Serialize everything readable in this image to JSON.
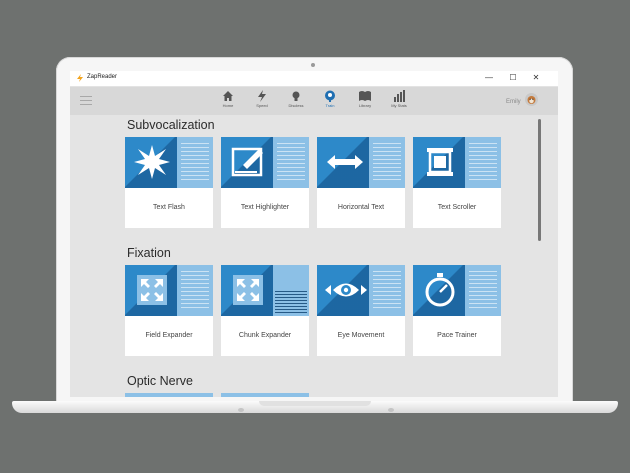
{
  "window": {
    "title": "ZapReader",
    "minimize": "—",
    "maximize": "☐",
    "close": "✕"
  },
  "nav": {
    "items": [
      {
        "label": "Home",
        "icon": "home-icon"
      },
      {
        "label": "Speed",
        "icon": "lightning-icon"
      },
      {
        "label": "Discless",
        "icon": "lightbulb-icon"
      },
      {
        "label": "Train",
        "icon": "brain-icon",
        "active": true
      },
      {
        "label": "Library",
        "icon": "book-icon"
      },
      {
        "label": "My Stats",
        "icon": "bar-chart-icon"
      }
    ],
    "user_name": "Emily"
  },
  "sections": [
    {
      "title": "Subvocalization",
      "cards": [
        "Text Flash",
        "Text Highlighter",
        "Horizontal Text",
        "Text Scroller"
      ]
    },
    {
      "title": "Fixation",
      "cards": [
        "Field Expander",
        "Chunk Expander",
        "Eye Movement",
        "Pace Trainer"
      ]
    },
    {
      "title": "Optic Nerve",
      "cards": []
    }
  ],
  "colors": {
    "accent_dark": "#2d89c9",
    "accent_light": "#8cc0e6",
    "active_nav": "#1f6fb2"
  }
}
